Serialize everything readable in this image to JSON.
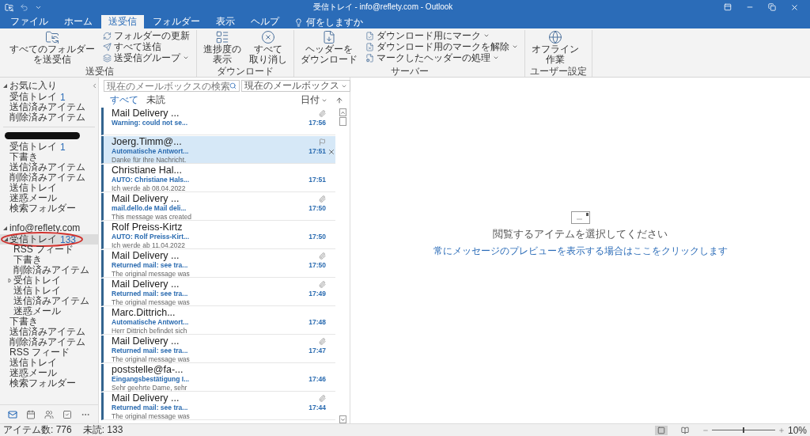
{
  "window": {
    "title": "受信トレイ - info@reflety.com - Outlook"
  },
  "tabs": [
    {
      "label": "ファイル",
      "selected": false
    },
    {
      "label": "ホーム",
      "selected": false
    },
    {
      "label": "送受信",
      "selected": true
    },
    {
      "label": "フォルダー",
      "selected": false
    },
    {
      "label": "表示",
      "selected": false
    },
    {
      "label": "ヘルプ",
      "selected": false
    }
  ],
  "tell_me": {
    "placeholder": "何をしますか"
  },
  "ribbon": {
    "groups": [
      {
        "label": "送受信",
        "buttons": [
          {
            "kind": "large",
            "lines": [
              "すべてのフォルダー",
              "を送受信"
            ]
          },
          {
            "kind": "small",
            "label": "フォルダーの更新",
            "dropdown": false
          },
          {
            "kind": "small",
            "label": "すべて送信",
            "dropdown": false
          },
          {
            "kind": "small",
            "label": "送受信グループ",
            "dropdown": true
          }
        ]
      },
      {
        "label": "ダウンロード",
        "buttons": [
          {
            "kind": "large",
            "lines": [
              "進捗度の",
              "表示"
            ]
          },
          {
            "kind": "large",
            "lines": [
              "すべて",
              "取り消し"
            ]
          }
        ]
      },
      {
        "label": "サーバー",
        "buttons": [
          {
            "kind": "large",
            "lines": [
              "ヘッダーを",
              "ダウンロード"
            ]
          },
          {
            "kind": "small",
            "label": "ダウンロード用にマーク",
            "dropdown": true
          },
          {
            "kind": "small",
            "label": "ダウンロード用のマークを解除",
            "dropdown": true
          },
          {
            "kind": "small",
            "label": "マークしたヘッダーの処理",
            "dropdown": true
          }
        ]
      },
      {
        "label": "ユーザー設定",
        "buttons": [
          {
            "kind": "large",
            "lines": [
              "オフライン",
              "作業"
            ]
          }
        ]
      }
    ]
  },
  "sidebar": {
    "sections": [
      {
        "kind": "favorites",
        "title": "お気に入り",
        "expanded": true,
        "folders": [
          {
            "name": "受信トレイ",
            "count": "1",
            "selected": false
          },
          {
            "name": "送信済みアイテム",
            "selected": false
          },
          {
            "name": "削除済みアイテム",
            "selected": false
          }
        ]
      },
      {
        "kind": "redacted",
        "folders": [
          {
            "name": "受信トレイ",
            "count": "1",
            "selected": false
          },
          {
            "name": "下書き",
            "selected": false
          },
          {
            "name": "送信済みアイテム",
            "selected": false
          },
          {
            "name": "削除済みアイテム",
            "selected": false
          },
          {
            "name": "送信トレイ",
            "selected": false
          },
          {
            "name": "迷惑メール",
            "selected": false
          },
          {
            "name": "検索フォルダー",
            "selected": false
          }
        ]
      },
      {
        "kind": "account",
        "title": "info@reflety.com",
        "expanded": true,
        "folders": [
          {
            "name": "受信トレイ",
            "count": "133",
            "selected": true,
            "circled": true,
            "expanded": true,
            "children": [
              {
                "name": "RSS フィード",
                "selected": false
              },
              {
                "name": "下書き",
                "selected": false
              },
              {
                "name": "削除済みアイテム",
                "selected": false
              },
              {
                "name": "受信トレイ",
                "selected": false,
                "expanded": false
              },
              {
                "name": "送信トレイ",
                "selected": false
              },
              {
                "name": "送信済みアイテム",
                "selected": false
              },
              {
                "name": "迷惑メール",
                "selected": false
              }
            ]
          },
          {
            "name": "下書き",
            "selected": false
          },
          {
            "name": "送信済みアイテム",
            "selected": false
          },
          {
            "name": "削除済みアイテム",
            "selected": false
          },
          {
            "name": "RSS フィード",
            "selected": false
          },
          {
            "name": "送信トレイ",
            "selected": false
          },
          {
            "name": "迷惑メール",
            "selected": false
          },
          {
            "name": "検索フォルダー",
            "selected": false
          }
        ]
      }
    ],
    "nav": [
      {
        "kind": "mail",
        "selected": true
      },
      {
        "kind": "calendar",
        "selected": false
      },
      {
        "kind": "people",
        "selected": false
      },
      {
        "kind": "tasks",
        "selected": false
      },
      {
        "kind": "more",
        "selected": false
      }
    ]
  },
  "mail": {
    "search": {
      "placeholder": "現在のメールボックスの検索",
      "scope": "現在のメールボックス"
    },
    "filters": [
      {
        "label": "すべて",
        "selected": true
      },
      {
        "label": "未読",
        "selected": false
      }
    ],
    "sort": {
      "label": "日付"
    },
    "items": [
      {
        "sender": "Mail Delivery ...",
        "subject": "Warning: could not se...",
        "time": "17:56",
        "attachment": true,
        "unread": true,
        "selected": false
      },
      {
        "sender": "Joerg.Timm@...",
        "subject": "Automatische Antwort...",
        "preview": "Danke für Ihre Nachricht.",
        "time": "17:51",
        "attachment": false,
        "unread": true,
        "selected": true
      },
      {
        "sender": "Christiane Hal...",
        "subject": "AUTO: Christiane Hals...",
        "preview": "Ich werde ab  08.04.2022",
        "time": "17:51",
        "attachment": false,
        "unread": true,
        "selected": false
      },
      {
        "sender": "Mail Delivery ...",
        "subject": "mail.dello.de Mail deli...",
        "preview": "This message was created",
        "time": "17:50",
        "attachment": true,
        "unread": true,
        "selected": false
      },
      {
        "sender": "Rolf Preiss-Kirtz",
        "subject": "AUTO: Rolf Preiss-Kirt...",
        "preview": "Ich werde ab  11.04.2022",
        "time": "17:50",
        "attachment": false,
        "unread": true,
        "selected": false
      },
      {
        "sender": "Mail Delivery ...",
        "subject": "Returned mail: see tra...",
        "preview": "The original message was",
        "time": "17:50",
        "attachment": true,
        "unread": true,
        "selected": false
      },
      {
        "sender": "Mail Delivery ...",
        "subject": "Returned mail: see tra...",
        "preview": "The original message was",
        "time": "17:49",
        "attachment": true,
        "unread": true,
        "selected": false
      },
      {
        "sender": "Marc.Dittrich...",
        "subject": "Automatische Antwort...",
        "preview": "Herr Dittrich befindet sich",
        "time": "17:48",
        "attachment": false,
        "unread": true,
        "selected": false
      },
      {
        "sender": "Mail Delivery ...",
        "subject": "Returned mail: see tra...",
        "preview": "The original message was",
        "time": "17:47",
        "attachment": true,
        "unread": true,
        "selected": false
      },
      {
        "sender": "poststelle@fa-...",
        "subject": "Eingangsbestätigung I...",
        "preview": "Sehr geehrte Dame, sehr",
        "time": "17:46",
        "attachment": false,
        "unread": true,
        "selected": false
      },
      {
        "sender": "Mail Delivery ...",
        "subject": "Returned mail: see tra...",
        "preview": "The original message was",
        "time": "17:44",
        "attachment": true,
        "unread": true,
        "selected": false
      }
    ]
  },
  "reading_pane": {
    "message": "閲覧するアイテムを選択してください",
    "link": "常にメッセージのプレビューを表示する場合はここをクリックします"
  },
  "status_bar": {
    "items_count": "アイテム数: 776",
    "unread_count": "未読: 133",
    "views": [
      {
        "kind": "normal",
        "selected": true
      },
      {
        "kind": "reading",
        "selected": false
      }
    ],
    "zoom": {
      "level": 0.5,
      "reading": "10%"
    }
  }
}
